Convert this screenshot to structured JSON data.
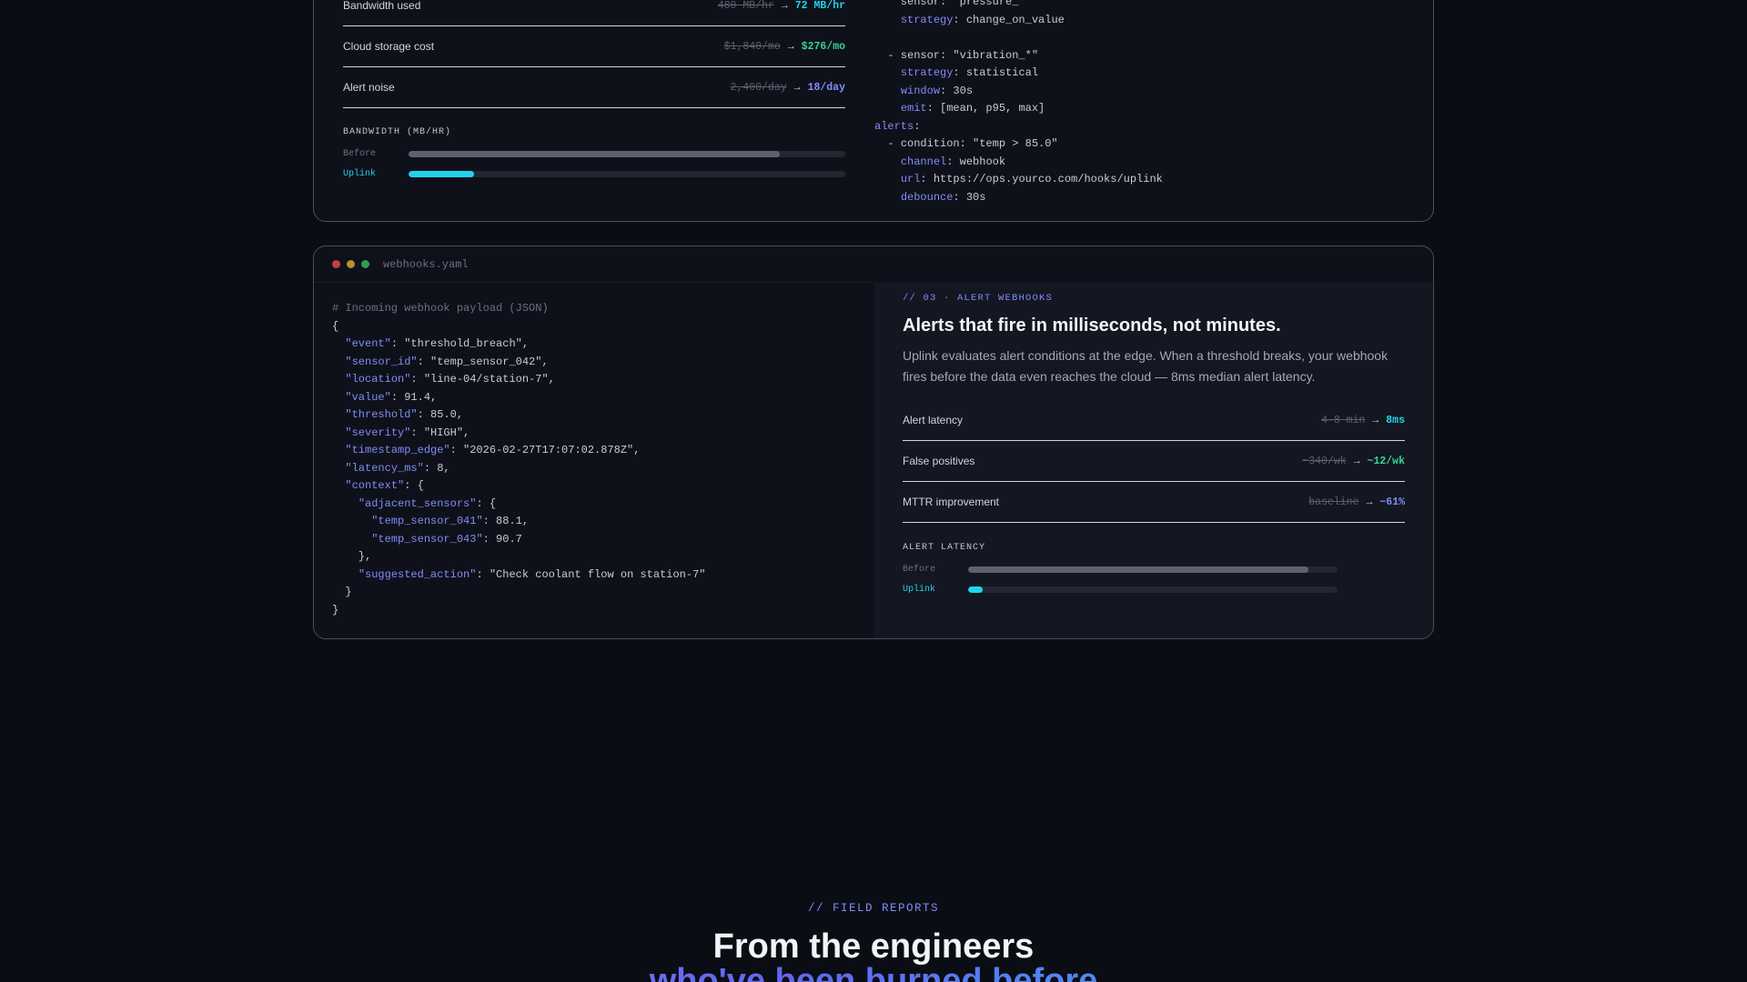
{
  "card1": {
    "metrics": [
      {
        "label": "Bandwidth used",
        "old": "480 MB/hr",
        "arrow": "→",
        "new": "72 MB/hr",
        "color": "#22d3ee"
      },
      {
        "label": "Cloud storage cost",
        "old": "$1,840/mo",
        "arrow": "→",
        "new": "$276/mo",
        "color": "#34d399"
      },
      {
        "label": "Alert noise",
        "old": "2,400/day",
        "arrow": "→",
        "new": "18/day",
        "color": "#818cf8"
      }
    ],
    "bars": {
      "title": "BANDWIDTH (MB/HR)",
      "before_label": "Before",
      "uplink_label": "Uplink",
      "before_fraction": 0.85,
      "uplink_fraction": 0.15
    },
    "code_lines": [
      [
        {
          "t": "    sensor: \"pressure_*\"",
          "c": ""
        }
      ],
      [
        {
          "t": "    ",
          "c": ""
        },
        {
          "t": "strategy",
          "c": "k"
        },
        {
          "t": ": change_on_value",
          "c": ""
        }
      ],
      [
        {
          "t": "",
          "c": ""
        }
      ],
      [
        {
          "t": "  - sensor: \"vibration_*\"",
          "c": ""
        }
      ],
      [
        {
          "t": "    ",
          "c": ""
        },
        {
          "t": "strategy",
          "c": "k"
        },
        {
          "t": ": statistical",
          "c": ""
        }
      ],
      [
        {
          "t": "    ",
          "c": ""
        },
        {
          "t": "window",
          "c": "k"
        },
        {
          "t": ": 30s",
          "c": ""
        }
      ],
      [
        {
          "t": "    ",
          "c": ""
        },
        {
          "t": "emit",
          "c": "k"
        },
        {
          "t": ": [mean, p95, max]",
          "c": ""
        }
      ],
      [
        {
          "t": "alerts",
          "c": "k"
        },
        {
          "t": ":",
          "c": ""
        }
      ],
      [
        {
          "t": "  - condition: \"temp > 85.0\"",
          "c": ""
        }
      ],
      [
        {
          "t": "    ",
          "c": ""
        },
        {
          "t": "channel",
          "c": "k"
        },
        {
          "t": ": webhook",
          "c": ""
        }
      ],
      [
        {
          "t": "    ",
          "c": ""
        },
        {
          "t": "url",
          "c": "k"
        },
        {
          "t": ": https://ops.yourco.com/hooks/uplink",
          "c": ""
        }
      ],
      [
        {
          "t": "    ",
          "c": ""
        },
        {
          "t": "debounce",
          "c": "k"
        },
        {
          "t": ": 30s",
          "c": ""
        }
      ]
    ]
  },
  "card2": {
    "filename": "webhooks.yaml",
    "code_lines": [
      [
        {
          "t": "# Incoming webhook payload (JSON)",
          "c": "cm"
        }
      ],
      [
        {
          "t": "{",
          "c": ""
        }
      ],
      [
        {
          "t": "  ",
          "c": ""
        },
        {
          "t": "\"event\"",
          "c": "k"
        },
        {
          "t": ": \"threshold_breach\",",
          "c": ""
        }
      ],
      [
        {
          "t": "  ",
          "c": ""
        },
        {
          "t": "\"sensor_id\"",
          "c": "k"
        },
        {
          "t": ": \"temp_sensor_042\",",
          "c": ""
        }
      ],
      [
        {
          "t": "  ",
          "c": ""
        },
        {
          "t": "\"location\"",
          "c": "k"
        },
        {
          "t": ": \"line-04/station-7\",",
          "c": ""
        }
      ],
      [
        {
          "t": "  ",
          "c": ""
        },
        {
          "t": "\"value\"",
          "c": "k"
        },
        {
          "t": ": 91.4,",
          "c": ""
        }
      ],
      [
        {
          "t": "  ",
          "c": ""
        },
        {
          "t": "\"threshold\"",
          "c": "k"
        },
        {
          "t": ": 85.0,",
          "c": ""
        }
      ],
      [
        {
          "t": "  ",
          "c": ""
        },
        {
          "t": "\"severity\"",
          "c": "k"
        },
        {
          "t": ": \"HIGH\",",
          "c": ""
        }
      ],
      [
        {
          "t": "  ",
          "c": ""
        },
        {
          "t": "\"timestamp_edge\"",
          "c": "k"
        },
        {
          "t": ": \"2026-02-27T17:07:02.878Z\",",
          "c": ""
        }
      ],
      [
        {
          "t": "  ",
          "c": ""
        },
        {
          "t": "\"latency_ms\"",
          "c": "k"
        },
        {
          "t": ": 8,",
          "c": ""
        }
      ],
      [
        {
          "t": "  ",
          "c": ""
        },
        {
          "t": "\"context\"",
          "c": "k"
        },
        {
          "t": ": {",
          "c": ""
        }
      ],
      [
        {
          "t": "    ",
          "c": ""
        },
        {
          "t": "\"adjacent_sensors\"",
          "c": "k"
        },
        {
          "t": ": {",
          "c": ""
        }
      ],
      [
        {
          "t": "      ",
          "c": ""
        },
        {
          "t": "\"temp_sensor_041\"",
          "c": "k"
        },
        {
          "t": ": 88.1,",
          "c": ""
        }
      ],
      [
        {
          "t": "      ",
          "c": ""
        },
        {
          "t": "\"temp_sensor_043\"",
          "c": "k"
        },
        {
          "t": ": 90.7",
          "c": ""
        }
      ],
      [
        {
          "t": "    },",
          "c": ""
        }
      ],
      [
        {
          "t": "    ",
          "c": ""
        },
        {
          "t": "\"suggested_action\"",
          "c": "k"
        },
        {
          "t": ": \"Check coolant flow on station-7\"",
          "c": ""
        }
      ],
      [
        {
          "t": "  }",
          "c": ""
        }
      ],
      [
        {
          "t": "}",
          "c": ""
        }
      ]
    ],
    "tag": "// 03 · ALERT WEBHOOKS",
    "heading": "Alerts that fire in milliseconds, not minutes.",
    "description_line1": "Uplink evaluates alert conditions at the edge. When a threshold breaks, your webhook",
    "description_line2": "fires before the data even reaches the cloud — 8ms median alert latency.",
    "metrics": [
      {
        "label": "Alert latency",
        "old": "4-8 min",
        "arrow": "→",
        "new": "8ms",
        "color": "#22d3ee"
      },
      {
        "label": "False positives",
        "old": "~340/wk",
        "arrow": "→",
        "new": "~12/wk",
        "color": "#34d399"
      },
      {
        "label": "MTTR improvement",
        "old": "baseline",
        "arrow": "→",
        "new": "−61%",
        "color": "#818cf8"
      }
    ],
    "bars": {
      "title": "ALERT LATENCY",
      "before_label": "Before",
      "uplink_label": "Uplink",
      "before_fraction": 0.92,
      "uplink_fraction": 0.04
    }
  },
  "field_reports": {
    "tag": "// FIELD REPORTS",
    "title": "From the engineers",
    "subtitle": "who've been burned before"
  }
}
